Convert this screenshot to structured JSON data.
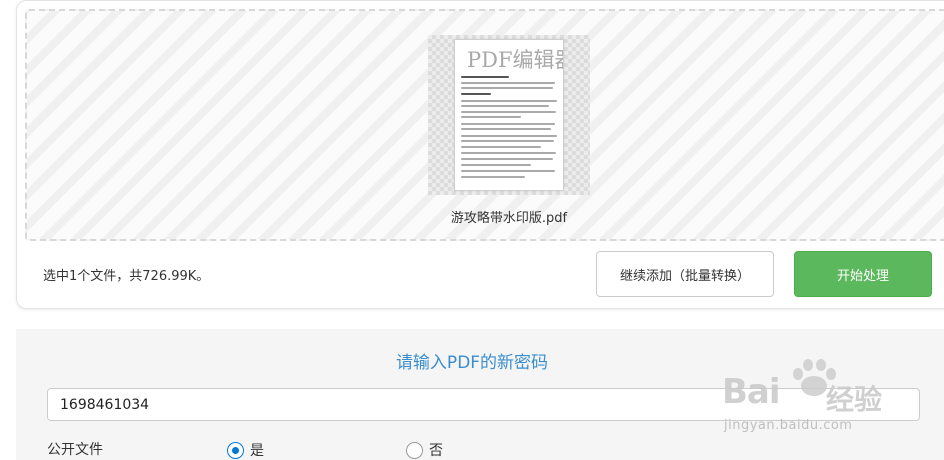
{
  "upload": {
    "file_name": "游攻略带水印版.pdf",
    "thumbnail_watermark": "PDF编辑器",
    "status_text": "选中1个文件，共726.99K。",
    "add_button_label": "继续添加（批量转换）",
    "start_button_label": "开始处理"
  },
  "password": {
    "title": "请输入PDF的新密码",
    "value": "1698461034",
    "public_label": "公开文件",
    "options": [
      {
        "label": "是",
        "checked": true
      },
      {
        "label": "否",
        "checked": false
      }
    ]
  },
  "watermark": {
    "brand_text": "Bai",
    "brand_cn": "经验",
    "url": "jingyan.baidu.com"
  },
  "colors": {
    "accent_blue": "#3a8ed0",
    "start_green": "#5cb85c",
    "radio_blue": "#0078d7"
  }
}
